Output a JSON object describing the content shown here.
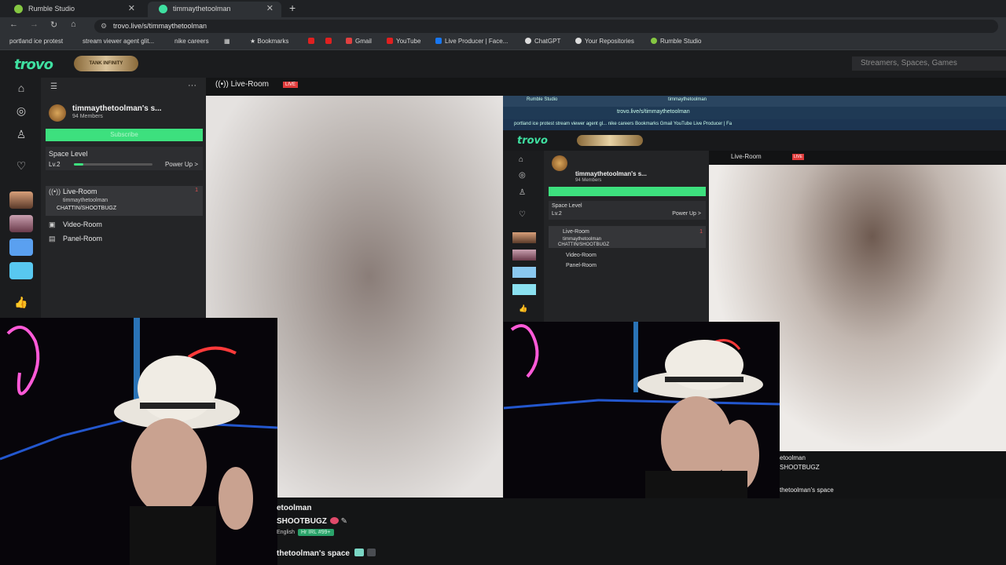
{
  "browser": {
    "tabs": [
      {
        "label": "Rumble Studio",
        "icon": "rumble-icon"
      },
      {
        "label": "timmaythetoolman",
        "icon": "trovo-icon"
      }
    ],
    "url": "trovo.live/s/timmaythetoolman",
    "bookmarks": [
      "portland ice protest",
      "stream viewer agent glit...",
      "nike careers",
      "Bookmarks",
      "Gmail",
      "YouTube",
      "Live Producer | Face...",
      "ChatGPT",
      "Your Repositories",
      "Rumble Studio"
    ]
  },
  "trovo": {
    "logo": "trovo",
    "banner": "TANK INFINITY",
    "search_placeholder": "Streamers, Spaces, Games"
  },
  "sidebar": {
    "space_name": "timmaythetoolman's s...",
    "members": "94 Members",
    "subscribe": "Subscribe",
    "space_level_title": "Space Level",
    "level": "Lv.2",
    "level_progress": 0.12,
    "power_up": "Power Up >",
    "rooms": [
      {
        "label": "Live-Room",
        "count": "1",
        "host": "timmaythetoolman",
        "activity": "CHATTIN/SHOOTBUGZ"
      },
      {
        "label": "Video-Room"
      },
      {
        "label": "Panel-Room"
      }
    ]
  },
  "main": {
    "room_title": "Live-Room",
    "live_badge": "LIVE",
    "channel_name": "etoolman",
    "stream_title": "SHOOTBUGZ",
    "language": "English",
    "tag": "Hr IRL #99+",
    "space_label": "thetoolman's space"
  },
  "inner": {
    "tab1": "Rumble Studio",
    "tab2": "timmaythetoolman",
    "url": "trovo.live/s/timmaythetoolman",
    "bookmarks": "portland ice protest    stream viewer agent gl...    nike careers    Bookmarks    Gmail    YouTube    Live Producer | Fa",
    "space_name": "timmaythetoolman's s...",
    "members": "94 Members",
    "space_level_title": "Space Level",
    "level": "Lv.2",
    "power_up": "Power Up >",
    "rooms": [
      "Live-Room",
      "timmaythetoolman",
      "CHATTIN/SHOOTBUGZ",
      "Video-Room",
      "Panel-Room"
    ],
    "room_count": "1",
    "room_title": "Live-Room",
    "live_badge": "LIVE",
    "channel_name": "etoolman",
    "stream_title": "SHOOTBUGZ",
    "space_label": "thetoolman's space"
  }
}
